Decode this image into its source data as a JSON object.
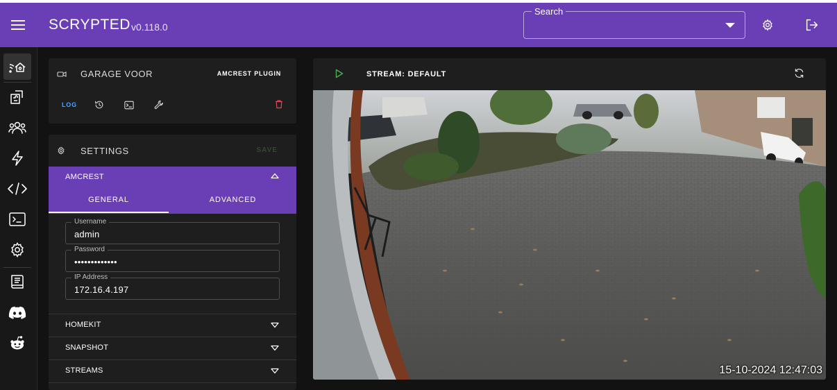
{
  "app": {
    "brand": "SCRYPTED",
    "version": "v0.118.0"
  },
  "search": {
    "legend": "Search",
    "value": ""
  },
  "icons": {
    "menu": "hamburger-menu-icon",
    "settings": "gear-icon",
    "logout": "logout-icon"
  },
  "sidebar": {
    "items": [
      {
        "id": "devices",
        "icon": "home-signal-icon",
        "active": true
      },
      {
        "id": "plugins",
        "icon": "puzzle-box-icon"
      },
      {
        "id": "users",
        "icon": "users-icon"
      },
      {
        "id": "automations",
        "icon": "bolt-icon"
      },
      {
        "id": "scripts",
        "icon": "code-icon"
      },
      {
        "id": "terminal",
        "icon": "terminal-icon"
      },
      {
        "id": "settings",
        "icon": "gear-icon"
      },
      {
        "id": "docs",
        "icon": "book-icon"
      },
      {
        "id": "discord",
        "icon": "discord-icon"
      },
      {
        "id": "reddit",
        "icon": "reddit-icon"
      }
    ]
  },
  "device": {
    "name": "GARAGE VOOR",
    "plugin_link": "AMCREST PLUGIN",
    "log_label": "LOG",
    "tools": [
      "history-icon",
      "console-icon",
      "wrench-icon"
    ],
    "delete_icon": "trash-icon"
  },
  "settings": {
    "title": "SETTINGS",
    "save_label": "SAVE",
    "group": {
      "title": "AMCREST",
      "tabs": [
        {
          "label": "GENERAL",
          "active": true
        },
        {
          "label": "ADVANCED",
          "active": false
        }
      ],
      "fields": [
        {
          "legend": "Username",
          "value": "admin"
        },
        {
          "legend": "Password",
          "value": "•••••••••••••"
        },
        {
          "legend": "IP Address",
          "value": "172.16.4.197"
        }
      ]
    },
    "sections": [
      {
        "title": "HOMEKIT"
      },
      {
        "title": "SNAPSHOT"
      },
      {
        "title": "STREAMS"
      }
    ]
  },
  "stream": {
    "title": "STREAM: DEFAULT",
    "timestamp": "15-10-2024 12:47:03"
  },
  "colors": {
    "accent": "#6a3fb6",
    "background": "#121212",
    "card": "#1e1e1e",
    "link": "#4aa3ff",
    "play": "#4caf50",
    "delete": "#e0485a"
  }
}
